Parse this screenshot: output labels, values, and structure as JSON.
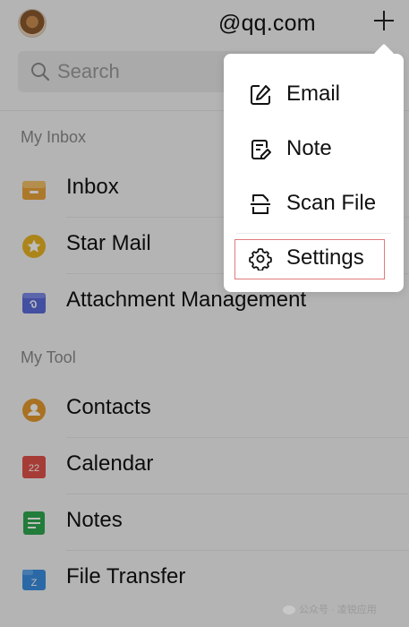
{
  "header": {
    "account": "@qq.com"
  },
  "search": {
    "placeholder": "Search"
  },
  "sections": {
    "my_inbox": "My Inbox",
    "my_tool": "My Tool"
  },
  "inbox_items": [
    {
      "label": "Inbox",
      "icon": "inbox-tray-icon",
      "color": "#e8a43a"
    },
    {
      "label": "Star Mail",
      "icon": "star-icon",
      "color": "#e8b424"
    },
    {
      "label": "Attachment Management",
      "icon": "attachment-folder-icon",
      "color": "#5b6bd8"
    }
  ],
  "tool_items": [
    {
      "label": "Contacts",
      "icon": "contacts-icon",
      "color": "#e49a2e"
    },
    {
      "label": "Calendar",
      "icon": "calendar-icon",
      "color": "#e0524a",
      "badge": "22"
    },
    {
      "label": "Notes",
      "icon": "notes-icon",
      "color": "#2fa84f"
    },
    {
      "label": "File Transfer",
      "icon": "file-transfer-icon",
      "color": "#3b8ee0",
      "badge": "Z"
    }
  ],
  "menu": {
    "items": [
      {
        "label": "Email",
        "icon": "compose-icon"
      },
      {
        "label": "Note",
        "icon": "note-icon"
      },
      {
        "label": "Scan File",
        "icon": "scan-icon"
      },
      {
        "label": "Settings",
        "icon": "gear-icon"
      }
    ]
  },
  "watermark": {
    "text": "公众号 · 凌锐应用"
  }
}
